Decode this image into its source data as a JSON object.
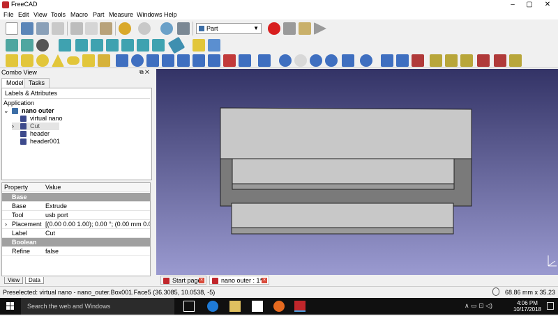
{
  "window": {
    "title": "FreeCAD",
    "minimize": "–",
    "maximize": "▢",
    "close": "✕"
  },
  "menu": [
    "File",
    "Edit",
    "View",
    "Tools",
    "Macro",
    "Part",
    "Measure",
    "Windows",
    "Help"
  ],
  "toolbar": {
    "workbench": "Part"
  },
  "combo": {
    "title": "Combo View",
    "tabs": [
      "Model",
      "Tasks"
    ],
    "tree_header": "Labels & Attributes",
    "application": "Application",
    "document": "nano outer",
    "items": [
      {
        "label": "virtual nano",
        "expandable": false,
        "selected": false
      },
      {
        "label": "Cut",
        "expandable": true,
        "selected": true
      },
      {
        "label": "header",
        "expandable": false,
        "selected": false
      },
      {
        "label": "header001",
        "expandable": false,
        "selected": false
      }
    ]
  },
  "properties": {
    "col_property": "Property",
    "col_value": "Value",
    "rows": [
      {
        "type": "group",
        "name": "Base"
      },
      {
        "type": "prop",
        "name": "Base",
        "value": "Extrude"
      },
      {
        "type": "prop",
        "name": "Tool",
        "value": "usb port"
      },
      {
        "type": "prop",
        "name": "Placement",
        "value": "[(0.00 0.00 1.00); 0.00 °; (0.00 mm  0.00 m...",
        "expandable": true
      },
      {
        "type": "prop",
        "name": "Label",
        "value": "Cut"
      },
      {
        "type": "group",
        "name": "Boolean"
      },
      {
        "type": "prop",
        "name": "Refine",
        "value": "false"
      }
    ],
    "bottom_tabs": [
      "View",
      "Data"
    ]
  },
  "doc_tabs": [
    "Start page",
    "nano outer : 1*"
  ],
  "status": {
    "message": "Preselected: virtual nano - nano_outer.Box001.Face5 (36.3085, 10.0538, -5)",
    "dimensions": "68.86 mm x 35.23 mm"
  },
  "taskbar": {
    "search_placeholder": "Search the web and Windows",
    "time": "4:06 PM",
    "date": "10/17/2018"
  },
  "colors": {
    "viewport_top": "#333366",
    "viewport_bottom": "#9a9ad0",
    "accent_red": "#c0262b",
    "face_light": "#c8c8c8",
    "face_dark": "#7a7a7a"
  }
}
